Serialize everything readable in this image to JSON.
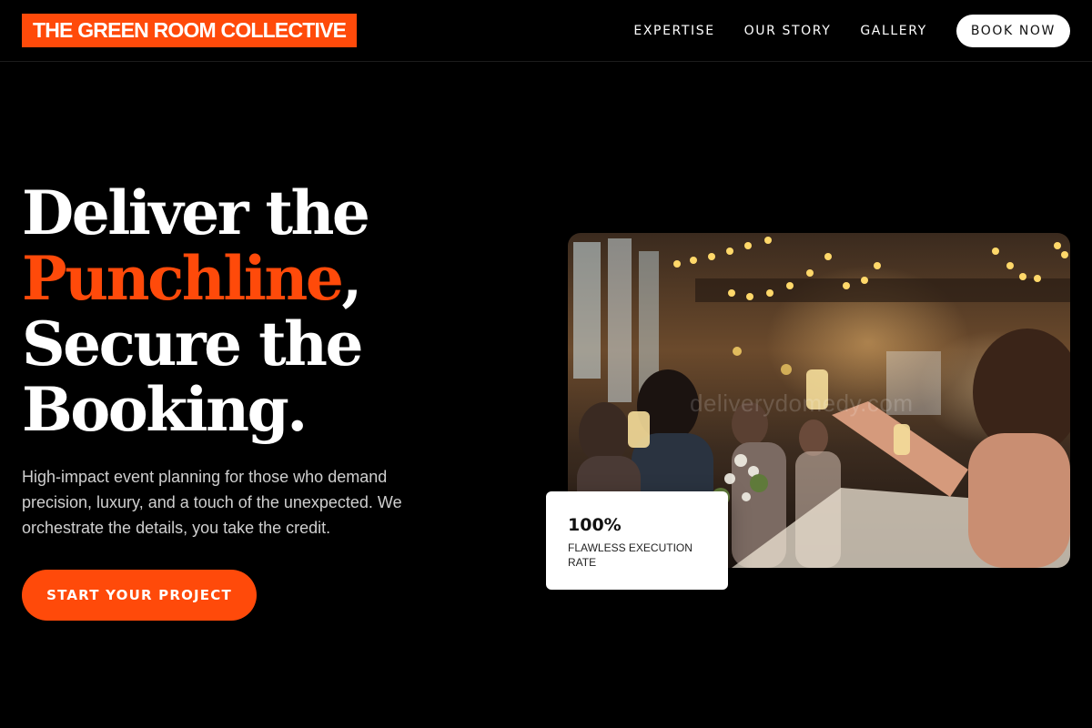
{
  "header": {
    "logo_text": "THE GREEN ROOM COLLECTIVE",
    "nav": [
      {
        "label": "EXPERTISE"
      },
      {
        "label": "OUR STORY"
      },
      {
        "label": "GALLERY"
      }
    ],
    "book_label": "BOOK NOW"
  },
  "hero": {
    "headline_line1": "Deliver the",
    "headline_accent": "Punchline",
    "headline_comma": ",",
    "headline_line3": "Secure the",
    "headline_line4": "Booking.",
    "subtext": "High-impact event planning for those who demand precision, luxury, and a touch of the unexpected. We orchestrate the details, you take the credit.",
    "cta_label": "START YOUR PROJECT",
    "photo_watermark": "deliverydomedy.com"
  },
  "stat": {
    "value": "100%",
    "label": "FLAWLESS EXECUTION RATE"
  },
  "colors": {
    "accent": "#ff4a0a",
    "background": "#000000",
    "text": "#ffffff"
  }
}
